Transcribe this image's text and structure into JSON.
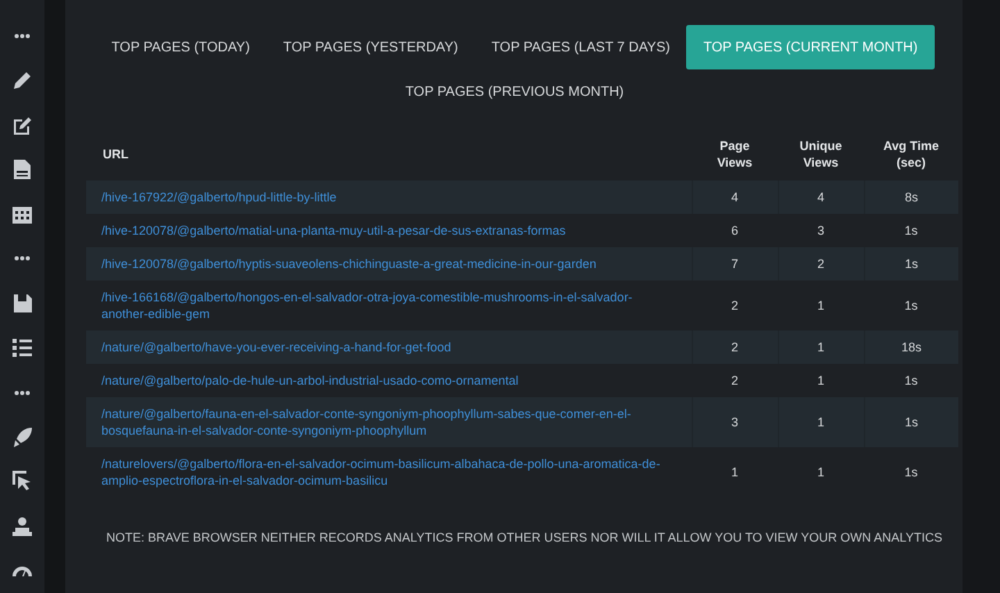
{
  "sidebar": {
    "items": [
      {
        "kind": "dots"
      },
      {
        "kind": "pencil"
      },
      {
        "kind": "edit"
      },
      {
        "kind": "document"
      },
      {
        "kind": "calendar"
      },
      {
        "kind": "dots"
      },
      {
        "kind": "save"
      },
      {
        "kind": "list"
      },
      {
        "kind": "dots"
      },
      {
        "kind": "rocket"
      },
      {
        "kind": "cursor"
      },
      {
        "kind": "person"
      },
      {
        "kind": "gauge"
      }
    ]
  },
  "tabs": [
    {
      "label": "TOP PAGES (TODAY)",
      "selected": false
    },
    {
      "label": "TOP PAGES (YESTERDAY)",
      "selected": false
    },
    {
      "label": "TOP PAGES (LAST 7 DAYS)",
      "selected": false
    },
    {
      "label": "TOP PAGES (CURRENT MONTH)",
      "selected": true
    },
    {
      "label": "TOP PAGES (PREVIOUS MONTH)",
      "selected": false
    }
  ],
  "table": {
    "columns": [
      "URL",
      "Page Views",
      "Unique Views",
      "Avg Time (sec)"
    ],
    "rows": [
      {
        "url": "/hive-167922/@galberto/hpud-little-by-little",
        "page_views": "4",
        "unique_views": "4",
        "avg_time": "8s"
      },
      {
        "url": "/hive-120078/@galberto/matial-una-planta-muy-util-a-pesar-de-sus-extranas-formas",
        "page_views": "6",
        "unique_views": "3",
        "avg_time": "1s"
      },
      {
        "url": "/hive-120078/@galberto/hyptis-suaveolens-chichinguaste-a-great-medicine-in-our-garden",
        "page_views": "7",
        "unique_views": "2",
        "avg_time": "1s"
      },
      {
        "url": "/hive-166168/@galberto/hongos-en-el-salvador-otra-joya-comestible-mushrooms-in-el-salvador-another-edible-gem",
        "page_views": "2",
        "unique_views": "1",
        "avg_time": "1s"
      },
      {
        "url": "/nature/@galberto/have-you-ever-receiving-a-hand-for-get-food",
        "page_views": "2",
        "unique_views": "1",
        "avg_time": "18s"
      },
      {
        "url": "/nature/@galberto/palo-de-hule-un-arbol-industrial-usado-como-ornamental",
        "page_views": "2",
        "unique_views": "1",
        "avg_time": "1s"
      },
      {
        "url": "/nature/@galberto/fauna-en-el-salvador-conte-syngoniym-phoophyllum-sabes-que-comer-en-el-bosquefauna-in-el-salvador-conte-syngoniym-phoophyllum",
        "page_views": "3",
        "unique_views": "1",
        "avg_time": "1s"
      },
      {
        "url": "/naturelovers/@galberto/flora-en-el-salvador-ocimum-basilicum-albahaca-de-pollo-una-aromatica-de-amplio-espectroflora-in-el-salvador-ocimum-basilicu",
        "page_views": "1",
        "unique_views": "1",
        "avg_time": "1s"
      }
    ]
  },
  "note": "NOTE: BRAVE BROWSER NEITHER RECORDS ANALYTICS FROM OTHER USERS NOR WILL IT ALLOW YOU TO VIEW YOUR OWN ANALYTICS"
}
